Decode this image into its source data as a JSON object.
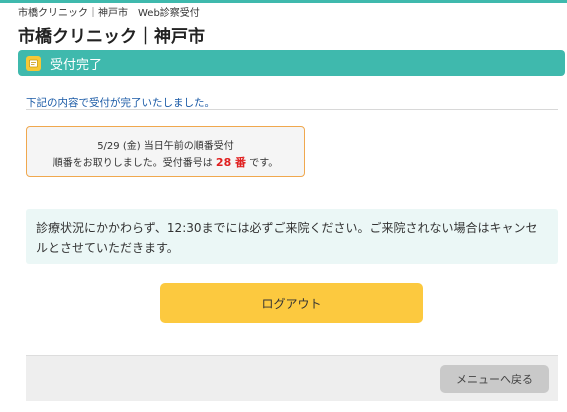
{
  "header": {
    "breadcrumb": "市橋クリニック｜神戸市　Web診察受付",
    "clinic_title": "市橋クリニック｜神戸市"
  },
  "banner": {
    "icon": "ticket-icon",
    "title": "受付完了"
  },
  "intro_text": "下記の内容で受付が完了いたしました。",
  "receipt": {
    "line1": "5/29 (金) 当日午前の順番受付",
    "line2_prefix": "順番をお取りしました。受付番号は ",
    "number": "28 番",
    "line2_suffix": " です。"
  },
  "notice": "診療状況にかかわらず、12:30までには必ずご来院ください。ご来院されない場合はキャンセルとさせていただきます。",
  "buttons": {
    "logout": "ログアウト",
    "back_to_menu": "メニューへ戻る"
  },
  "colors": {
    "accent": "#3fb9ad",
    "button_yellow": "#fcc93f",
    "receipt_border": "#f0a84e",
    "number_red": "#e02020",
    "intro_blue": "#1a5aa6"
  }
}
